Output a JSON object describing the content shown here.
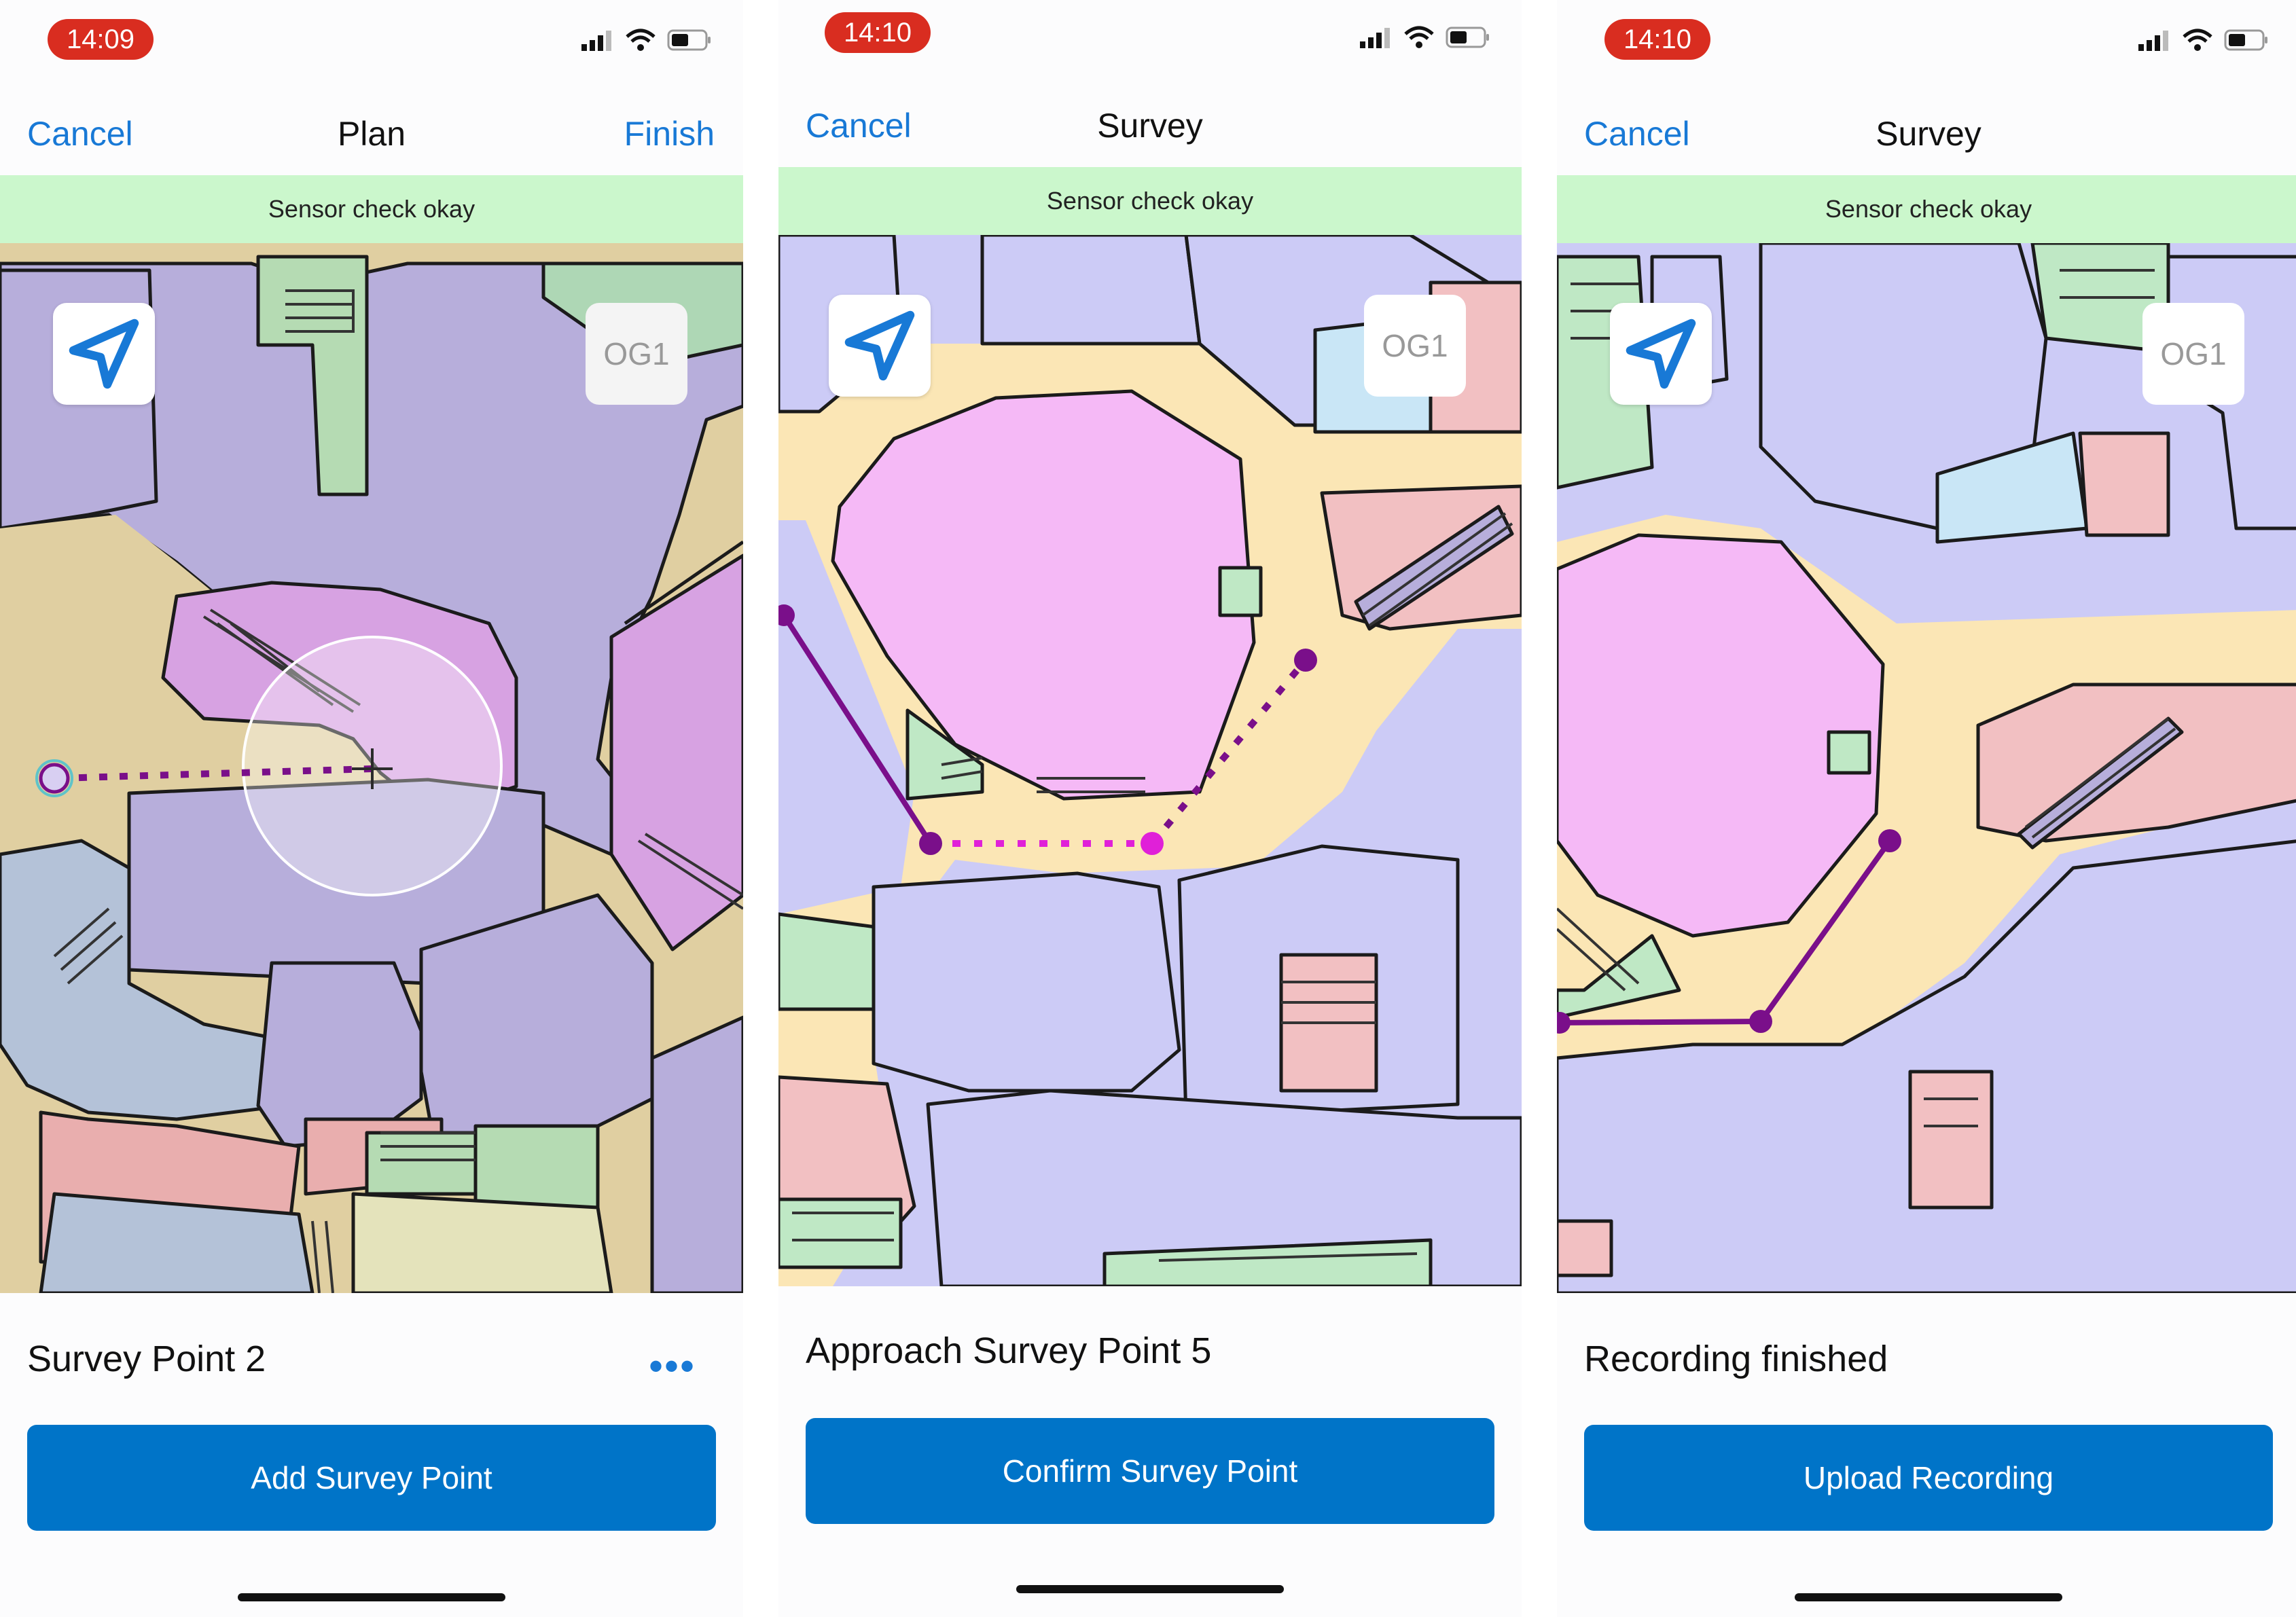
{
  "screens": [
    {
      "time": "14:09",
      "nav": {
        "cancel": "Cancel",
        "title": "Plan",
        "finish": "Finish"
      },
      "sensor_status": "Sensor check okay",
      "map": {
        "floor": "OG1",
        "locate_icon": "location-arrow-icon"
      },
      "status_line": "Survey Point 2",
      "more_label": "•••",
      "action_label": "Add Survey Point"
    },
    {
      "time": "14:10",
      "nav": {
        "cancel": "Cancel",
        "title": "Survey"
      },
      "sensor_status": "Sensor check okay",
      "map": {
        "floor": "OG1",
        "locate_icon": "location-arrow-icon"
      },
      "status_line": "Approach Survey Point 5",
      "action_label": "Confirm Survey Point"
    },
    {
      "time": "14:10",
      "nav": {
        "cancel": "Cancel",
        "title": "Survey"
      },
      "sensor_status": "Sensor check okay",
      "map": {
        "floor": "OG1",
        "locate_icon": "location-arrow-icon"
      },
      "status_line": "Recording finished",
      "action_label": "Upload Recording"
    }
  ],
  "colors": {
    "accent": "#1879d6",
    "button": "#0074c8",
    "time_pill": "#d92d20",
    "sensor_ok": "#cbf7cc",
    "path": "#7a0f8a",
    "active_point": "#e020d8"
  }
}
